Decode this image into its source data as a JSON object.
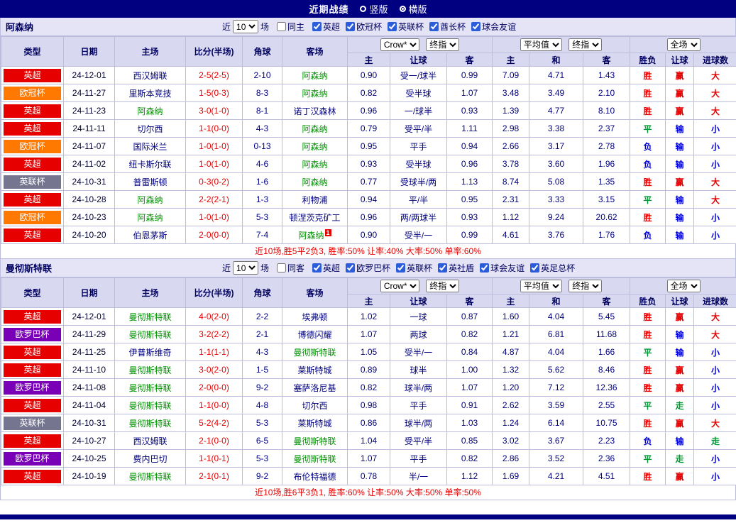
{
  "topbar": {
    "title": "近期战绩",
    "options": [
      {
        "label": "竖版",
        "selected": false
      },
      {
        "label": "横版",
        "selected": true
      }
    ]
  },
  "colors": {
    "accent_bar": "#000080",
    "focus_team": "#009100",
    "team": "#000080",
    "score": "#e60000",
    "odds": "#000080",
    "date": "#000030",
    "summary": "#e60000"
  },
  "league_colors": {
    "英超": "#e60000",
    "欧冠杯": "#ff7800",
    "英联杯": "#75758f",
    "欧罗巴杯": "#7a00b8"
  },
  "result_colors": {
    "胜": "#e60000",
    "赢": "#e60000",
    "大": "#e60000",
    "平": "#009933",
    "走": "#009933",
    "负": "#0000e0",
    "输": "#0000e0",
    "小": "#0000e0"
  },
  "sections": [
    {
      "team": "阿森纳",
      "filter": {
        "near": "近",
        "count": "10",
        "games": "场",
        "same": "同主",
        "same_checked": false,
        "leagues": [
          {
            "label": "英超",
            "checked": true
          },
          {
            "label": "欧冠杯",
            "checked": true
          },
          {
            "label": "英联杯",
            "checked": true
          },
          {
            "label": "酋长杯",
            "checked": true
          },
          {
            "label": "球会友谊",
            "checked": true
          }
        ]
      },
      "table": {
        "main_columns": [
          "类型",
          "日期",
          "主场",
          "比分(半场)",
          "角球",
          "客场"
        ],
        "group1": {
          "selects": [
            "Crow*",
            "终指"
          ],
          "sub": [
            "主",
            "让球",
            "客"
          ]
        },
        "group2": {
          "selects": [
            "平均值",
            "终指"
          ],
          "sub": [
            "主",
            "和",
            "客"
          ]
        },
        "group3": {
          "selects": [
            "全场"
          ],
          "sub": [
            "胜负",
            "让球",
            "进球数"
          ]
        }
      },
      "rows": [
        {
          "league": "英超",
          "date": "24-12-01",
          "home": "西汉姆联",
          "score": "2-5(2-5)",
          "corner": "2-10",
          "away": "阿森纳",
          "odds": [
            "0.90",
            "受一/球半",
            "0.99",
            "7.09",
            "4.71",
            "1.43"
          ],
          "res": [
            "胜",
            "赢",
            "大"
          ]
        },
        {
          "league": "欧冠杯",
          "date": "24-11-27",
          "home": "里斯本竞技",
          "score": "1-5(0-3)",
          "corner": "8-3",
          "away": "阿森纳",
          "odds": [
            "0.82",
            "受半球",
            "1.07",
            "3.48",
            "3.49",
            "2.10"
          ],
          "res": [
            "胜",
            "赢",
            "大"
          ]
        },
        {
          "league": "英超",
          "date": "24-11-23",
          "home": "阿森纳",
          "score": "3-0(1-0)",
          "corner": "8-1",
          "away": "诺丁汉森林",
          "odds": [
            "0.96",
            "一/球半",
            "0.93",
            "1.39",
            "4.77",
            "8.10"
          ],
          "res": [
            "胜",
            "赢",
            "大"
          ]
        },
        {
          "league": "英超",
          "date": "24-11-11",
          "home": "切尔西",
          "score": "1-1(0-0)",
          "corner": "4-3",
          "away": "阿森纳",
          "odds": [
            "0.79",
            "受平/半",
            "1.11",
            "2.98",
            "3.38",
            "2.37"
          ],
          "res": [
            "平",
            "输",
            "小"
          ]
        },
        {
          "league": "欧冠杯",
          "date": "24-11-07",
          "home": "国际米兰",
          "score": "1-0(1-0)",
          "corner": "0-13",
          "away": "阿森纳",
          "odds": [
            "0.95",
            "平手",
            "0.94",
            "2.66",
            "3.17",
            "2.78"
          ],
          "res": [
            "负",
            "输",
            "小"
          ]
        },
        {
          "league": "英超",
          "date": "24-11-02",
          "home": "纽卡斯尔联",
          "score": "1-0(1-0)",
          "corner": "4-6",
          "away": "阿森纳",
          "odds": [
            "0.93",
            "受半球",
            "0.96",
            "3.78",
            "3.60",
            "1.96"
          ],
          "res": [
            "负",
            "输",
            "小"
          ]
        },
        {
          "league": "英联杯",
          "date": "24-10-31",
          "home": "普雷斯顿",
          "score": "0-3(0-2)",
          "corner": "1-6",
          "away": "阿森纳",
          "odds": [
            "0.77",
            "受球半/两",
            "1.13",
            "8.74",
            "5.08",
            "1.35"
          ],
          "res": [
            "胜",
            "赢",
            "大"
          ]
        },
        {
          "league": "英超",
          "date": "24-10-28",
          "home": "阿森纳",
          "score": "2-2(2-1)",
          "corner": "1-3",
          "away": "利物浦",
          "odds": [
            "0.94",
            "平/半",
            "0.95",
            "2.31",
            "3.33",
            "3.15"
          ],
          "res": [
            "平",
            "输",
            "大"
          ]
        },
        {
          "league": "欧冠杯",
          "date": "24-10-23",
          "home": "阿森纳",
          "score": "1-0(1-0)",
          "corner": "5-3",
          "away": "顿涅茨克矿工",
          "odds": [
            "0.96",
            "两/两球半",
            "0.93",
            "1.12",
            "9.24",
            "20.62"
          ],
          "res": [
            "胜",
            "输",
            "小"
          ]
        },
        {
          "league": "英超",
          "date": "24-10-20",
          "home": "伯恩茅斯",
          "score": "2-0(0-0)",
          "corner": "7-4",
          "away": "阿森纳",
          "away_sup": "1",
          "odds": [
            "0.90",
            "受半/一",
            "0.99",
            "4.61",
            "3.76",
            "1.76"
          ],
          "res": [
            "负",
            "输",
            "小"
          ]
        }
      ],
      "summary": "近10场,胜5平2负3, 胜率:50% 让率:40% 大率:50% 单率:60%"
    },
    {
      "team": "曼彻斯特联",
      "filter": {
        "near": "近",
        "count": "10",
        "games": "场",
        "same": "同客",
        "same_checked": false,
        "leagues": [
          {
            "label": "英超",
            "checked": true
          },
          {
            "label": "欧罗巴杯",
            "checked": true
          },
          {
            "label": "英联杯",
            "checked": true
          },
          {
            "label": "英社盾",
            "checked": true
          },
          {
            "label": "球会友谊",
            "checked": true
          },
          {
            "label": "英足总杯",
            "checked": true
          }
        ]
      },
      "table": {
        "main_columns": [
          "类型",
          "日期",
          "主场",
          "比分(半场)",
          "角球",
          "客场"
        ],
        "group1": {
          "selects": [
            "Crow*",
            "终指"
          ],
          "sub": [
            "主",
            "让球",
            "客"
          ]
        },
        "group2": {
          "selects": [
            "平均值",
            "终指"
          ],
          "sub": [
            "主",
            "和",
            "客"
          ]
        },
        "group3": {
          "selects": [
            "全场"
          ],
          "sub": [
            "胜负",
            "让球",
            "进球数"
          ]
        }
      },
      "rows": [
        {
          "league": "英超",
          "date": "24-12-01",
          "home": "曼彻斯特联",
          "score": "4-0(2-0)",
          "corner": "2-2",
          "away": "埃弗顿",
          "odds": [
            "1.02",
            "一球",
            "0.87",
            "1.60",
            "4.04",
            "5.45"
          ],
          "res": [
            "胜",
            "赢",
            "大"
          ]
        },
        {
          "league": "欧罗巴杯",
          "date": "24-11-29",
          "home": "曼彻斯特联",
          "score": "3-2(2-2)",
          "corner": "2-1",
          "away": "博德闪耀",
          "odds": [
            "1.07",
            "两球",
            "0.82",
            "1.21",
            "6.81",
            "11.68"
          ],
          "res": [
            "胜",
            "输",
            "大"
          ]
        },
        {
          "league": "英超",
          "date": "24-11-25",
          "home": "伊普斯维奇",
          "score": "1-1(1-1)",
          "corner": "4-3",
          "away": "曼彻斯特联",
          "odds": [
            "1.05",
            "受半/一",
            "0.84",
            "4.87",
            "4.04",
            "1.66"
          ],
          "res": [
            "平",
            "输",
            "小"
          ]
        },
        {
          "league": "英超",
          "date": "24-11-10",
          "home": "曼彻斯特联",
          "score": "3-0(2-0)",
          "corner": "1-5",
          "away": "莱斯特城",
          "odds": [
            "0.89",
            "球半",
            "1.00",
            "1.32",
            "5.62",
            "8.46"
          ],
          "res": [
            "胜",
            "赢",
            "小"
          ]
        },
        {
          "league": "欧罗巴杯",
          "date": "24-11-08",
          "home": "曼彻斯特联",
          "score": "2-0(0-0)",
          "corner": "9-2",
          "away": "塞萨洛尼基",
          "odds": [
            "0.82",
            "球半/两",
            "1.07",
            "1.20",
            "7.12",
            "12.36"
          ],
          "res": [
            "胜",
            "赢",
            "小"
          ]
        },
        {
          "league": "英超",
          "date": "24-11-04",
          "home": "曼彻斯特联",
          "score": "1-1(0-0)",
          "corner": "4-8",
          "away": "切尔西",
          "odds": [
            "0.98",
            "平手",
            "0.91",
            "2.62",
            "3.59",
            "2.55"
          ],
          "res": [
            "平",
            "走",
            "小"
          ]
        },
        {
          "league": "英联杯",
          "date": "24-10-31",
          "home": "曼彻斯特联",
          "score": "5-2(4-2)",
          "corner": "5-3",
          "away": "莱斯特城",
          "odds": [
            "0.86",
            "球半/两",
            "1.03",
            "1.24",
            "6.14",
            "10.75"
          ],
          "res": [
            "胜",
            "赢",
            "大"
          ]
        },
        {
          "league": "英超",
          "date": "24-10-27",
          "home": "西汉姆联",
          "score": "2-1(0-0)",
          "corner": "6-5",
          "away": "曼彻斯特联",
          "odds": [
            "1.04",
            "受平/半",
            "0.85",
            "3.02",
            "3.67",
            "2.23"
          ],
          "res": [
            "负",
            "输",
            "走"
          ]
        },
        {
          "league": "欧罗巴杯",
          "date": "24-10-25",
          "home": "费内巴切",
          "score": "1-1(0-1)",
          "corner": "5-3",
          "away": "曼彻斯特联",
          "odds": [
            "1.07",
            "平手",
            "0.82",
            "2.86",
            "3.52",
            "2.36"
          ],
          "res": [
            "平",
            "走",
            "小"
          ]
        },
        {
          "league": "英超",
          "date": "24-10-19",
          "home": "曼彻斯特联",
          "score": "2-1(0-1)",
          "corner": "9-2",
          "away": "布伦特福德",
          "odds": [
            "0.78",
            "半/一",
            "1.12",
            "1.69",
            "4.21",
            "4.51"
          ],
          "res": [
            "胜",
            "赢",
            "小"
          ]
        }
      ],
      "summary": "近10场,胜6平3负1, 胜率:60% 让率:50% 大率:50% 单率:50%"
    }
  ]
}
